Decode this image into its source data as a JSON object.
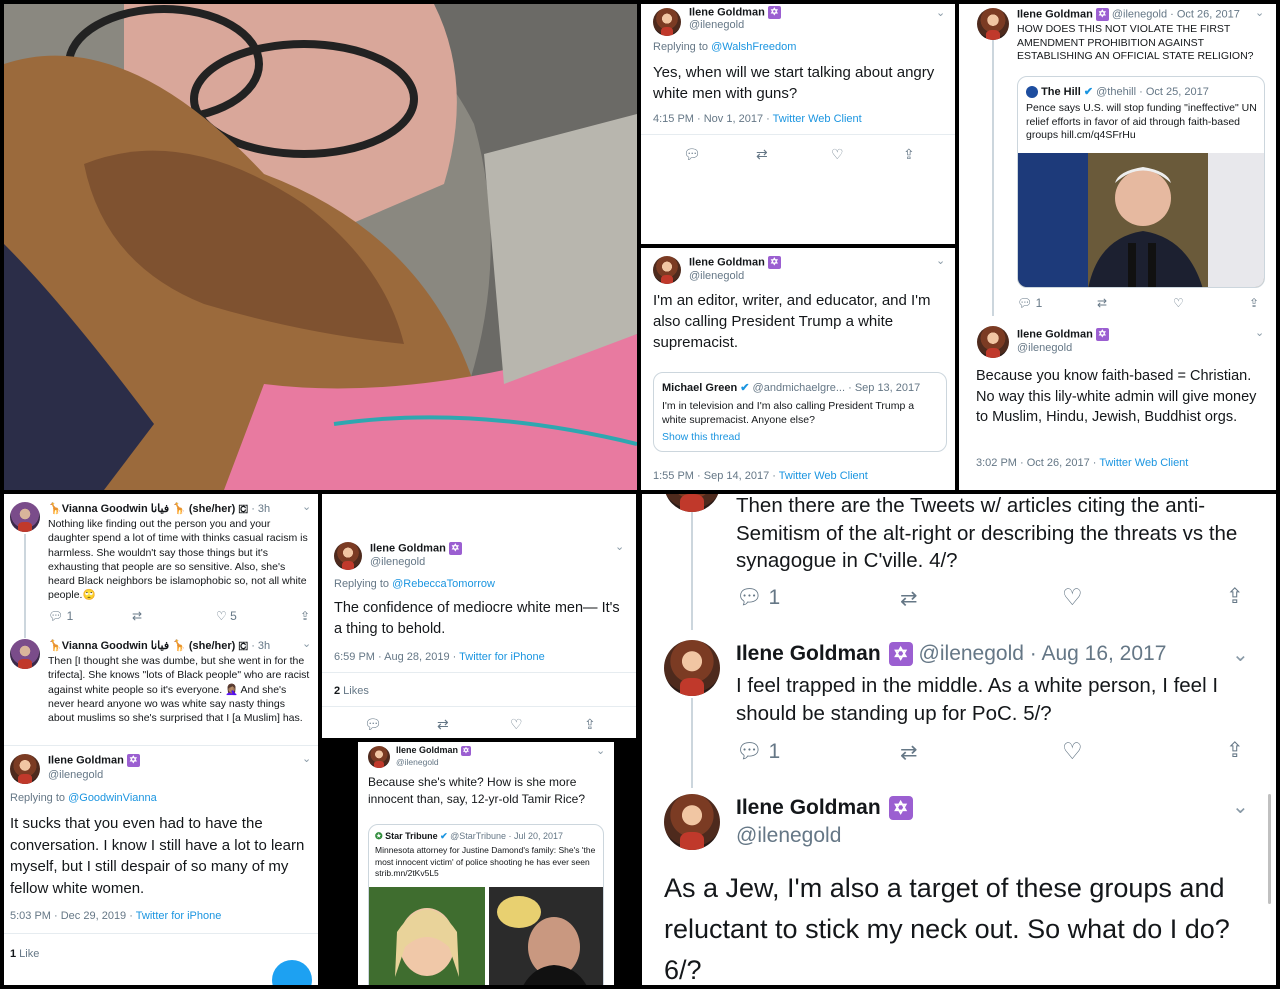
{
  "colors": {
    "accent": "#1b95e0",
    "star": "#9b5fd1",
    "text": "#14171a",
    "muted": "#657786"
  },
  "icons": [
    "reply-icon",
    "retweet-icon",
    "like-icon",
    "share-icon",
    "chevron-down-icon",
    "star-of-david-icon",
    "verified-icon"
  ],
  "author": {
    "name": "Ilene Goldman",
    "handle": "@ilenegold"
  },
  "t1": {
    "replying_prefix": "Replying to ",
    "replying_to": "@WalshFreedom",
    "text": "Yes, when will we start talking about angry white men with guns?",
    "time": "4:15 PM · Nov 1, 2017 · ",
    "client": "Twitter Web Client"
  },
  "t2": {
    "text": "I'm an editor, writer, and educator, and I'm also calling President Trump a white supremacist.",
    "quote_name": "Michael Green",
    "quote_handle": "@andmichaelgre... · Sep 13, 2017",
    "quote_text": "I'm in television and I'm also calling President Trump a white supremacist. Anyone else?",
    "quote_link": "Show this thread",
    "time": "1:55 PM · Sep 14, 2017 · ",
    "client": "Twitter Web Client"
  },
  "t3": {
    "handle_date": "@ilenegold · Oct 26, 2017",
    "text": "HOW DOES THIS NOT VIOLATE THE FIRST AMENDMENT PROHIBITION AGAINST ESTABLISHING AN OFFICIAL STATE RELIGION?",
    "quote_name": "The Hill",
    "quote_handle": "@thehill · Oct 25, 2017",
    "quote_text": "Pence says U.S. will stop funding \"ineffective\" UN relief efforts in favor of aid through faith-based groups hill.cm/q4SFrHu",
    "replies": "1"
  },
  "t4": {
    "text": "Because you know faith-based = Christian. No way this lily-white admin will give money to Muslim, Hindu, Jewish, Buddhist orgs.",
    "time": "3:02 PM · Oct 26, 2017 · ",
    "client": "Twitter Web Client"
  },
  "t5": {
    "name": "🦒Vianna Goodwin فيانا 🦒 (she/her) 🇨",
    "age": "· 3h",
    "text": "Nothing like finding out the person you and your daughter spend a lot of time with thinks casual racism is harmless. She wouldn't say those things but it's exhausting that people are so sensitive. Also, she's heard Black neighbors be islamophobic so,  not all white people.🙄",
    "replies": "1",
    "likes": "5"
  },
  "t6": {
    "name": "🦒Vianna Goodwin فيانا 🦒 (she/her) 🇨",
    "age": "· 3h",
    "text": "Then [I thought she was dumbe, but she went in for the trifecta]. She knows \"lots of Black people\" who are racist against white people so it's everyone. 🤦🏽‍♀️ And she's never heard anyone wo was white say nasty things about muslims so she's surprised that I [a Muslim] has."
  },
  "t7": {
    "replying_prefix": "Replying to ",
    "replying_to": "@GoodwinVianna",
    "text": "It sucks that you even had to have the conversation. I know I still have a lot to learn myself, but I still despair of so many of my fellow white women.",
    "time": "5:03 PM · Dec 29, 2019 · ",
    "client": "Twitter for iPhone",
    "likes_count": "1",
    "likes_label": " Like"
  },
  "t8": {
    "replying_prefix": "Replying to ",
    "replying_to": "@RebeccaTomorrow",
    "text": "The confidence of mediocre white men— It's a thing to behold.",
    "time": "6:59 PM · Aug 28, 2019 · ",
    "client": "Twitter for iPhone",
    "likes_count": "2",
    "likes_label": " Likes"
  },
  "t9": {
    "text": "Because she's white? How is she more innocent than, say, 12-yr-old Tamir Rice?",
    "quote_name": "Star Tribune",
    "quote_handle": "@StarTribune · Jul 20, 2017",
    "quote_text": "Minnesota attorney for Justine Damond's family: She's 'the most innocent victim' of police shooting he has ever seen strib.mn/2tKv5L5"
  },
  "t10": {
    "text": "Then there are the Tweets w/ articles citing the anti-Semitism of the alt-right or describing the threats vs the synagogue in C'ville. 4/?",
    "replies": "1"
  },
  "t11": {
    "handle_date": "@ilenegold · Aug 16, 2017",
    "text": "I feel trapped in the middle. As a white person, I feel I should be standing up for PoC. 5/?",
    "replies": "1"
  },
  "t12": {
    "text": "As a Jew, I'm also a target of these groups and reluctant to stick my neck out. So what do I do?  6/?"
  }
}
